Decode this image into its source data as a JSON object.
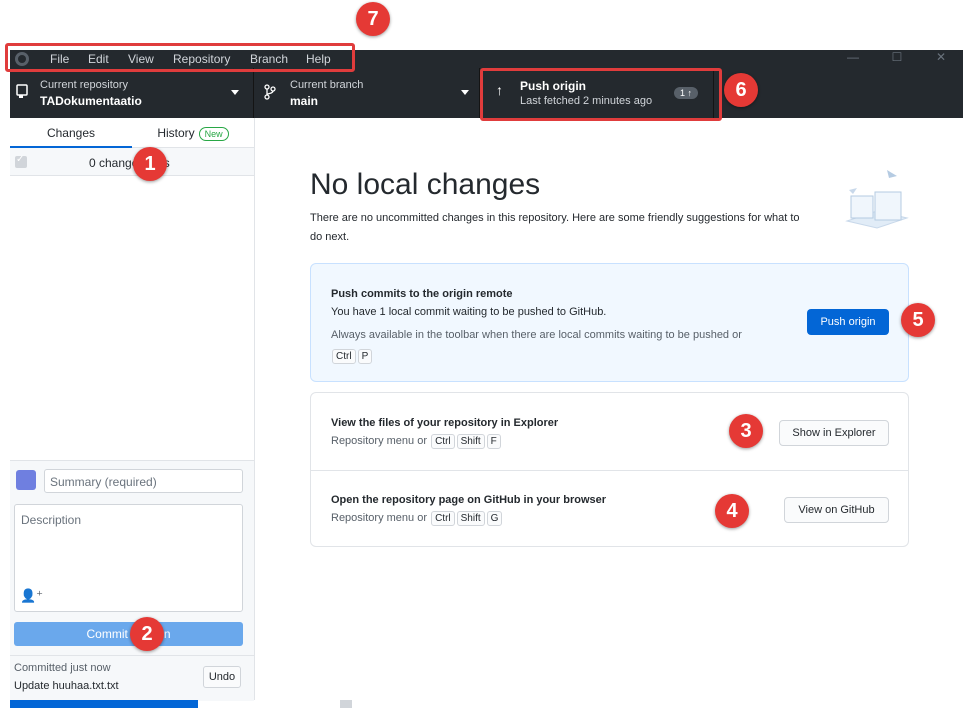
{
  "menu": {
    "items": [
      "File",
      "Edit",
      "View",
      "Repository",
      "Branch",
      "Help"
    ]
  },
  "toolbar": {
    "repo_label": "Current repository",
    "repo_value": "TADokumentaatio",
    "branch_label": "Current branch",
    "branch_value": "main",
    "push_title": "Push origin",
    "push_subtitle": "Last fetched 2 minutes ago",
    "push_badge": "1 ↑"
  },
  "sidebar": {
    "tab_changes": "Changes",
    "tab_history": "History",
    "history_badge": "New",
    "changes_count": "0 changed files",
    "summary_placeholder": "Summary (required)",
    "description_placeholder": "Description",
    "commit_button": "Commit to main",
    "last_commit_time": "Committed just now",
    "last_commit_message": "Update huuhaa.txt.txt",
    "undo_label": "Undo"
  },
  "main": {
    "title": "No local changes",
    "description": "There are no uncommitted changes in this repository. Here are some friendly suggestions for what to do next.",
    "push_card": {
      "title": "Push commits to the origin remote",
      "line": "You have 1 local commit waiting to be pushed to GitHub.",
      "hint": "Always available in the toolbar when there are local commits waiting to be pushed or",
      "keys": [
        "Ctrl",
        "P"
      ],
      "button": "Push origin"
    },
    "explorer_card": {
      "title": "View the files of your repository in Explorer",
      "hint": "Repository menu or",
      "keys": [
        "Ctrl",
        "Shift",
        "F"
      ],
      "button": "Show in Explorer"
    },
    "github_card": {
      "title": "Open the repository page on GitHub in your browser",
      "hint": "Repository menu or",
      "keys": [
        "Ctrl",
        "Shift",
        "G"
      ],
      "button": "View on GitHub"
    }
  },
  "annotations": [
    "1",
    "2",
    "3",
    "4",
    "5",
    "6",
    "7"
  ],
  "colors": {
    "accent": "#0366d6",
    "annotation": "#e53935",
    "toolbar_bg": "#24292e"
  }
}
